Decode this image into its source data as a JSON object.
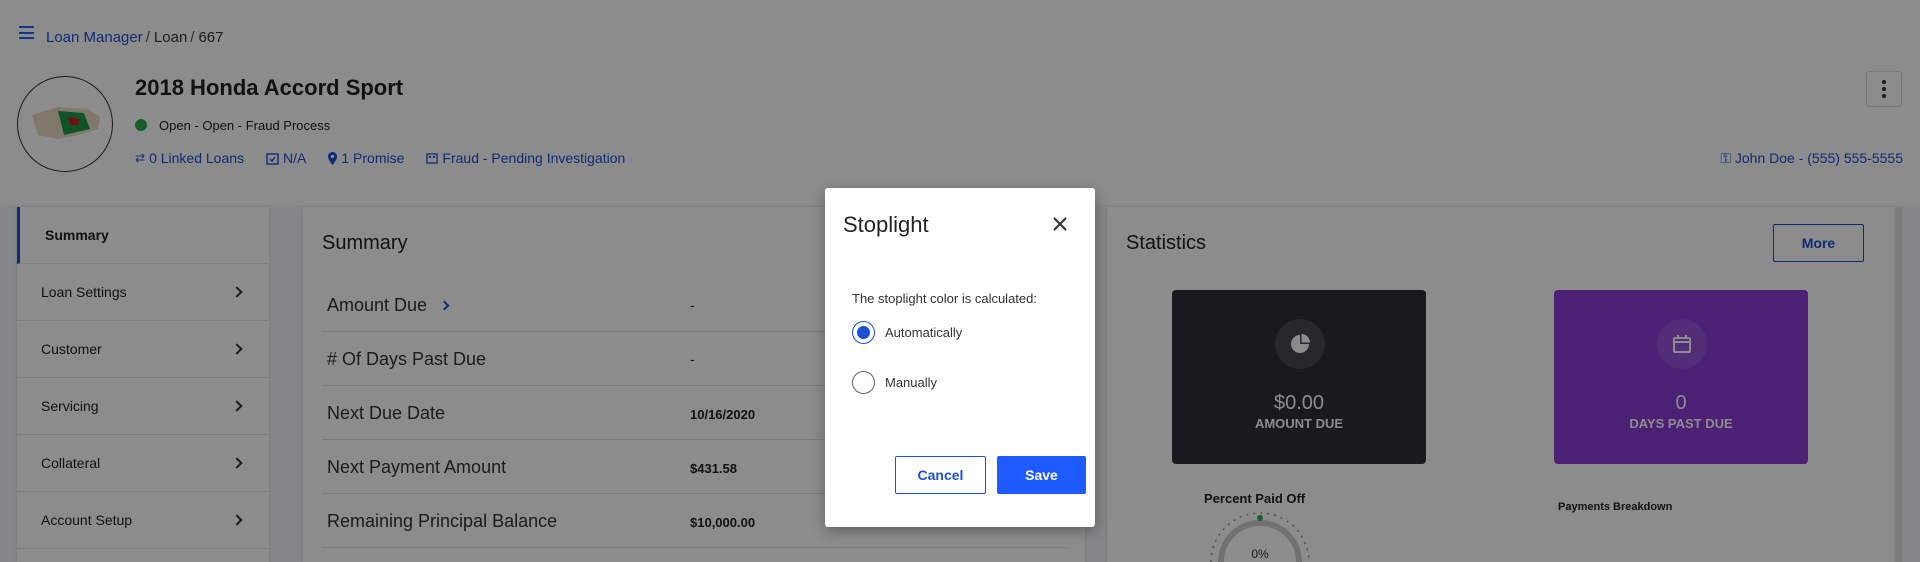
{
  "breadcrumb": {
    "root": "Loan Manager",
    "section": "Loan",
    "id": "667"
  },
  "loan": {
    "title": "2018 Honda Accord Sport",
    "status": "Open - Open - Fraud Process",
    "status_color": "#2eaa4a",
    "meta": {
      "linked_loans": "0 Linked Loans",
      "date": "N/A",
      "promise": "1 Promise",
      "fraud": "Fraud - Pending Investigation"
    },
    "contact": "John Doe - (555) 555-5555"
  },
  "sidebar": {
    "items": [
      {
        "label": "Summary"
      },
      {
        "label": "Loan Settings"
      },
      {
        "label": "Customer"
      },
      {
        "label": "Servicing"
      },
      {
        "label": "Collateral"
      },
      {
        "label": "Account Setup"
      }
    ]
  },
  "summary": {
    "title": "Summary",
    "rows": [
      {
        "label": "Amount Due",
        "value": "-"
      },
      {
        "label": "# Of Days Past Due",
        "value": "-"
      },
      {
        "label": "Next Due Date",
        "value": "10/16/2020"
      },
      {
        "label": "Next Payment Amount",
        "value": "$431.58"
      },
      {
        "label": "Remaining Principal Balance",
        "value": "$10,000.00"
      }
    ]
  },
  "statistics": {
    "title": "Statistics",
    "more_label": "More",
    "amount_due": {
      "value": "$0.00",
      "label": "AMOUNT DUE",
      "color": "#2b3039"
    },
    "days_past_due": {
      "value": "0",
      "label": "DAYS PAST DUE",
      "color": "#8a3bd6"
    },
    "percent_paid_off": {
      "title": "Percent Paid Off",
      "value": "0%"
    },
    "payments_breakdown": "Payments Breakdown"
  },
  "modal": {
    "title": "Stoplight",
    "prompt": "The stoplight color is calculated:",
    "options": [
      {
        "label": "Automatically",
        "selected": true
      },
      {
        "label": "Manually",
        "selected": false
      }
    ],
    "cancel_label": "Cancel",
    "save_label": "Save",
    "accent": "#1e5bff"
  }
}
